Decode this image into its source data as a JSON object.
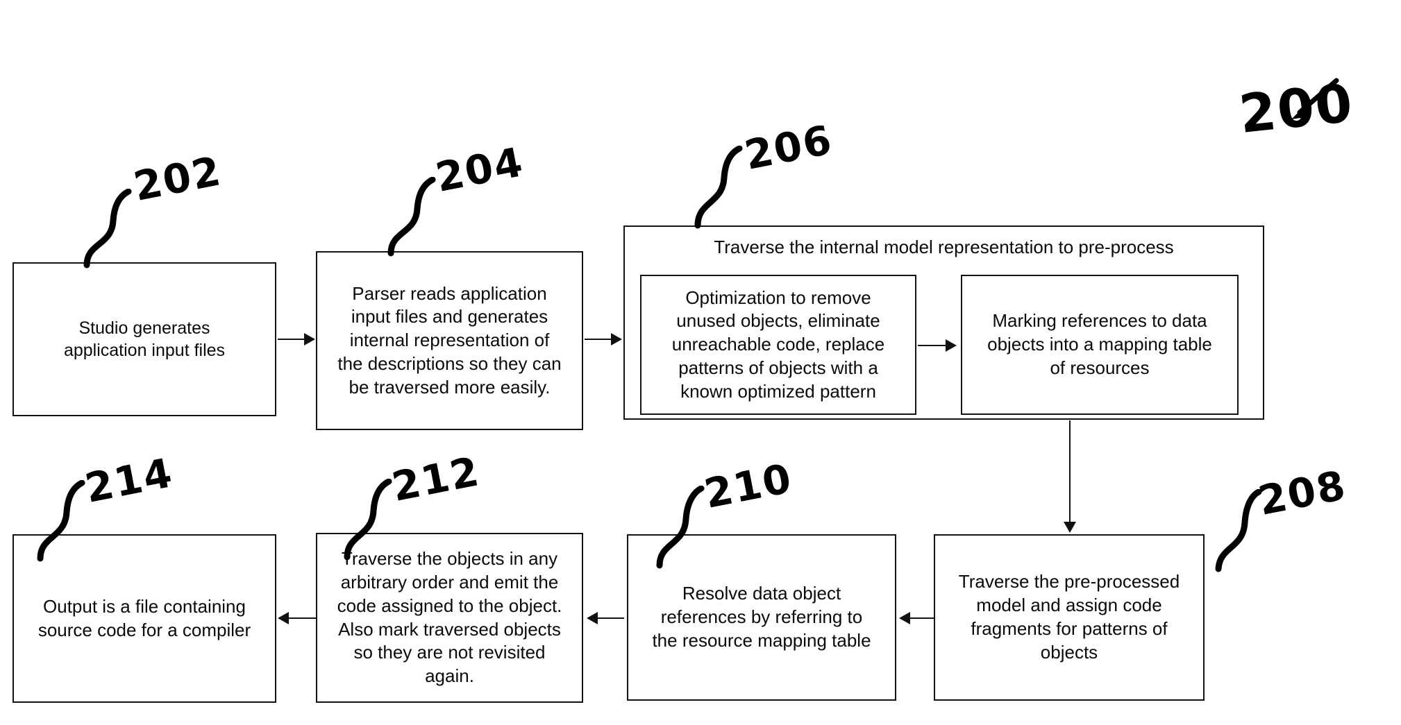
{
  "figure": {
    "number": "200",
    "type": "patent-flowchart"
  },
  "boxes": {
    "b202": {
      "ref": "202",
      "text": "Studio generates\napplication input files"
    },
    "b204": {
      "ref": "204",
      "text": "Parser reads application\ninput files and generates\ninternal representation of\nthe descriptions so they can\nbe traversed more easily."
    },
    "b206": {
      "ref": "206",
      "title": "Traverse the internal model representation to pre-process",
      "inner_left": "Optimization to remove\nunused objects, eliminate\nunreachable code, replace\npatterns of objects with a\nknown optimized pattern",
      "inner_right": "Marking references to data\nobjects into a mapping table\nof resources"
    },
    "b208": {
      "ref": "208",
      "text": "Traverse the pre-processed\nmodel and assign code\nfragments for patterns of\nobjects"
    },
    "b210": {
      "ref": "210",
      "text": "Resolve data object\nreferences by referring to\nthe resource mapping table"
    },
    "b212": {
      "ref": "212",
      "text": "Traverse the objects in any\narbitrary order and emit the\ncode assigned to the object.\nAlso mark traversed objects\nso they are not revisited\nagain."
    },
    "b214": {
      "ref": "214",
      "text": "Output is a file containing\nsource code for a compiler"
    }
  },
  "colors": {
    "ink": "#111111",
    "paper": "#ffffff"
  }
}
